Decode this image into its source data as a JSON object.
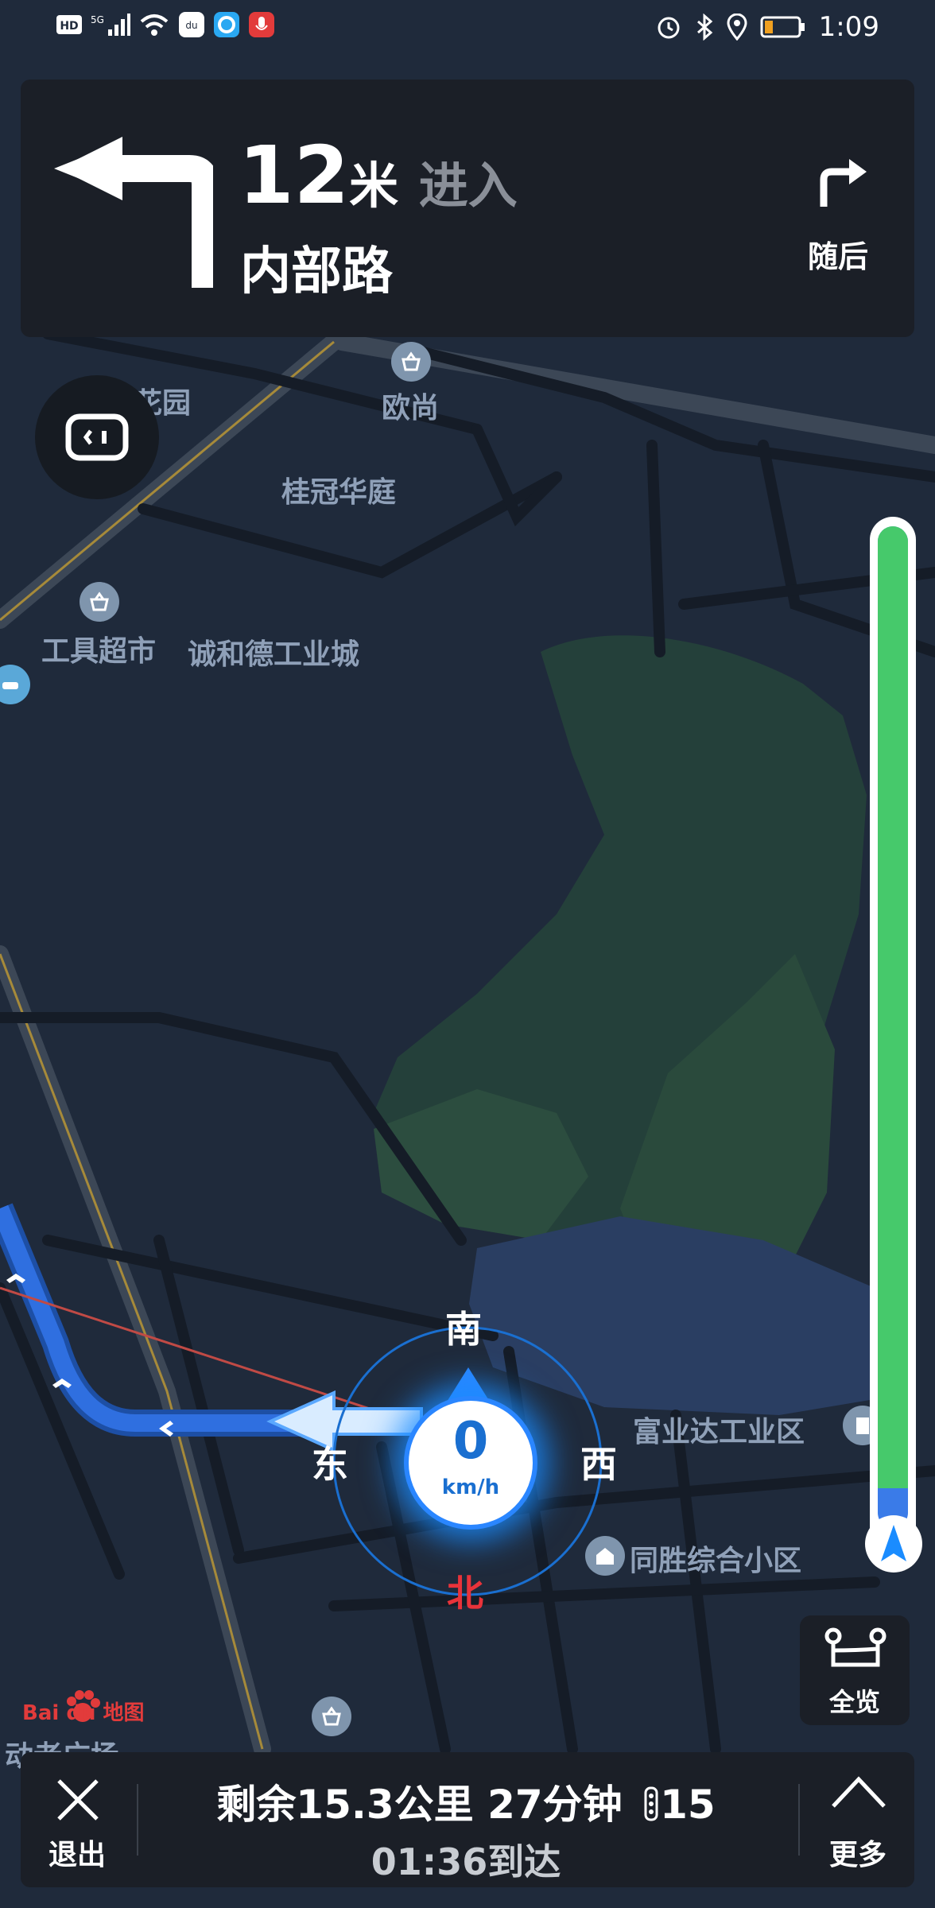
{
  "status": {
    "left_icons": [
      "hd-icon",
      "5g-signal-icon",
      "wifi-icon",
      "du-app-icon",
      "browser-app-icon",
      "mic-record-icon"
    ],
    "right_icons": [
      "alarm-icon",
      "bluetooth-icon",
      "location-icon",
      "battery-low-icon"
    ],
    "time": "1:09"
  },
  "guidance": {
    "distance_value": "12",
    "distance_unit": "米",
    "action": "进入",
    "road": "内部路",
    "next_turn_label": "随后",
    "turn_icon": "turn-left-icon",
    "next_turn_icon": "turn-right-icon"
  },
  "map": {
    "labels": [
      {
        "text": "花园"
      },
      {
        "text": "欧尚"
      },
      {
        "text": "桂冠华庭"
      },
      {
        "text": "工具超市"
      },
      {
        "text": "诚和德工业城"
      },
      {
        "text": "富业达工业区"
      },
      {
        "text": "同胜综合小区"
      },
      {
        "text": "动老广场"
      }
    ],
    "watermark": "Bai du 地图"
  },
  "compass": {
    "north": "北",
    "south": "南",
    "east": "东",
    "west": "西",
    "speed_value": "0",
    "speed_unit": "km/h"
  },
  "progress": {
    "remaining_fraction": 0.96,
    "color": "#46c96b"
  },
  "overview_button": {
    "label": "全览"
  },
  "bottom": {
    "exit_label": "退出",
    "more_label": "更多",
    "remaining_text": "剩余15.3公里 27分钟",
    "traffic_lights": "15",
    "arrival_text": "01:36到达"
  },
  "colors": {
    "route": "#2d6ad6",
    "accent": "#1a8cff",
    "north": "#e8333a",
    "card": "#1b1f27"
  }
}
